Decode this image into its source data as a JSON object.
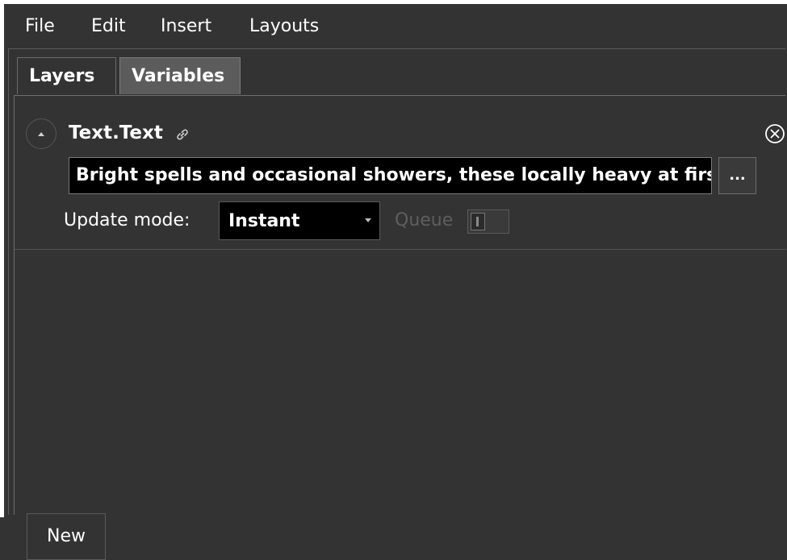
{
  "menu": {
    "items": [
      {
        "label": "File"
      },
      {
        "label": "Edit"
      },
      {
        "label": "Insert"
      },
      {
        "label": "Layouts"
      }
    ]
  },
  "tabs": [
    {
      "label": "Layers",
      "active": false
    },
    {
      "label": "Variables",
      "active": true
    }
  ],
  "variable": {
    "name": "Text.Text",
    "value": "Bright spells and occasional showers, these locally heavy at first",
    "browse_label": "...",
    "update_mode_label": "Update mode:",
    "update_mode_value": "Instant",
    "queue_label": "Queue",
    "queue_enabled": false
  },
  "footer": {
    "new_label": "New"
  },
  "icons": {
    "collapse": "collapse-icon",
    "link": "link-icon",
    "close": "close-circle-icon",
    "dropdown": "chevron-down-icon"
  },
  "colors": {
    "background": "#333333",
    "active_tab": "#5c5c5c",
    "input_bg": "#000000",
    "disabled_text": "#5e5e5e"
  }
}
